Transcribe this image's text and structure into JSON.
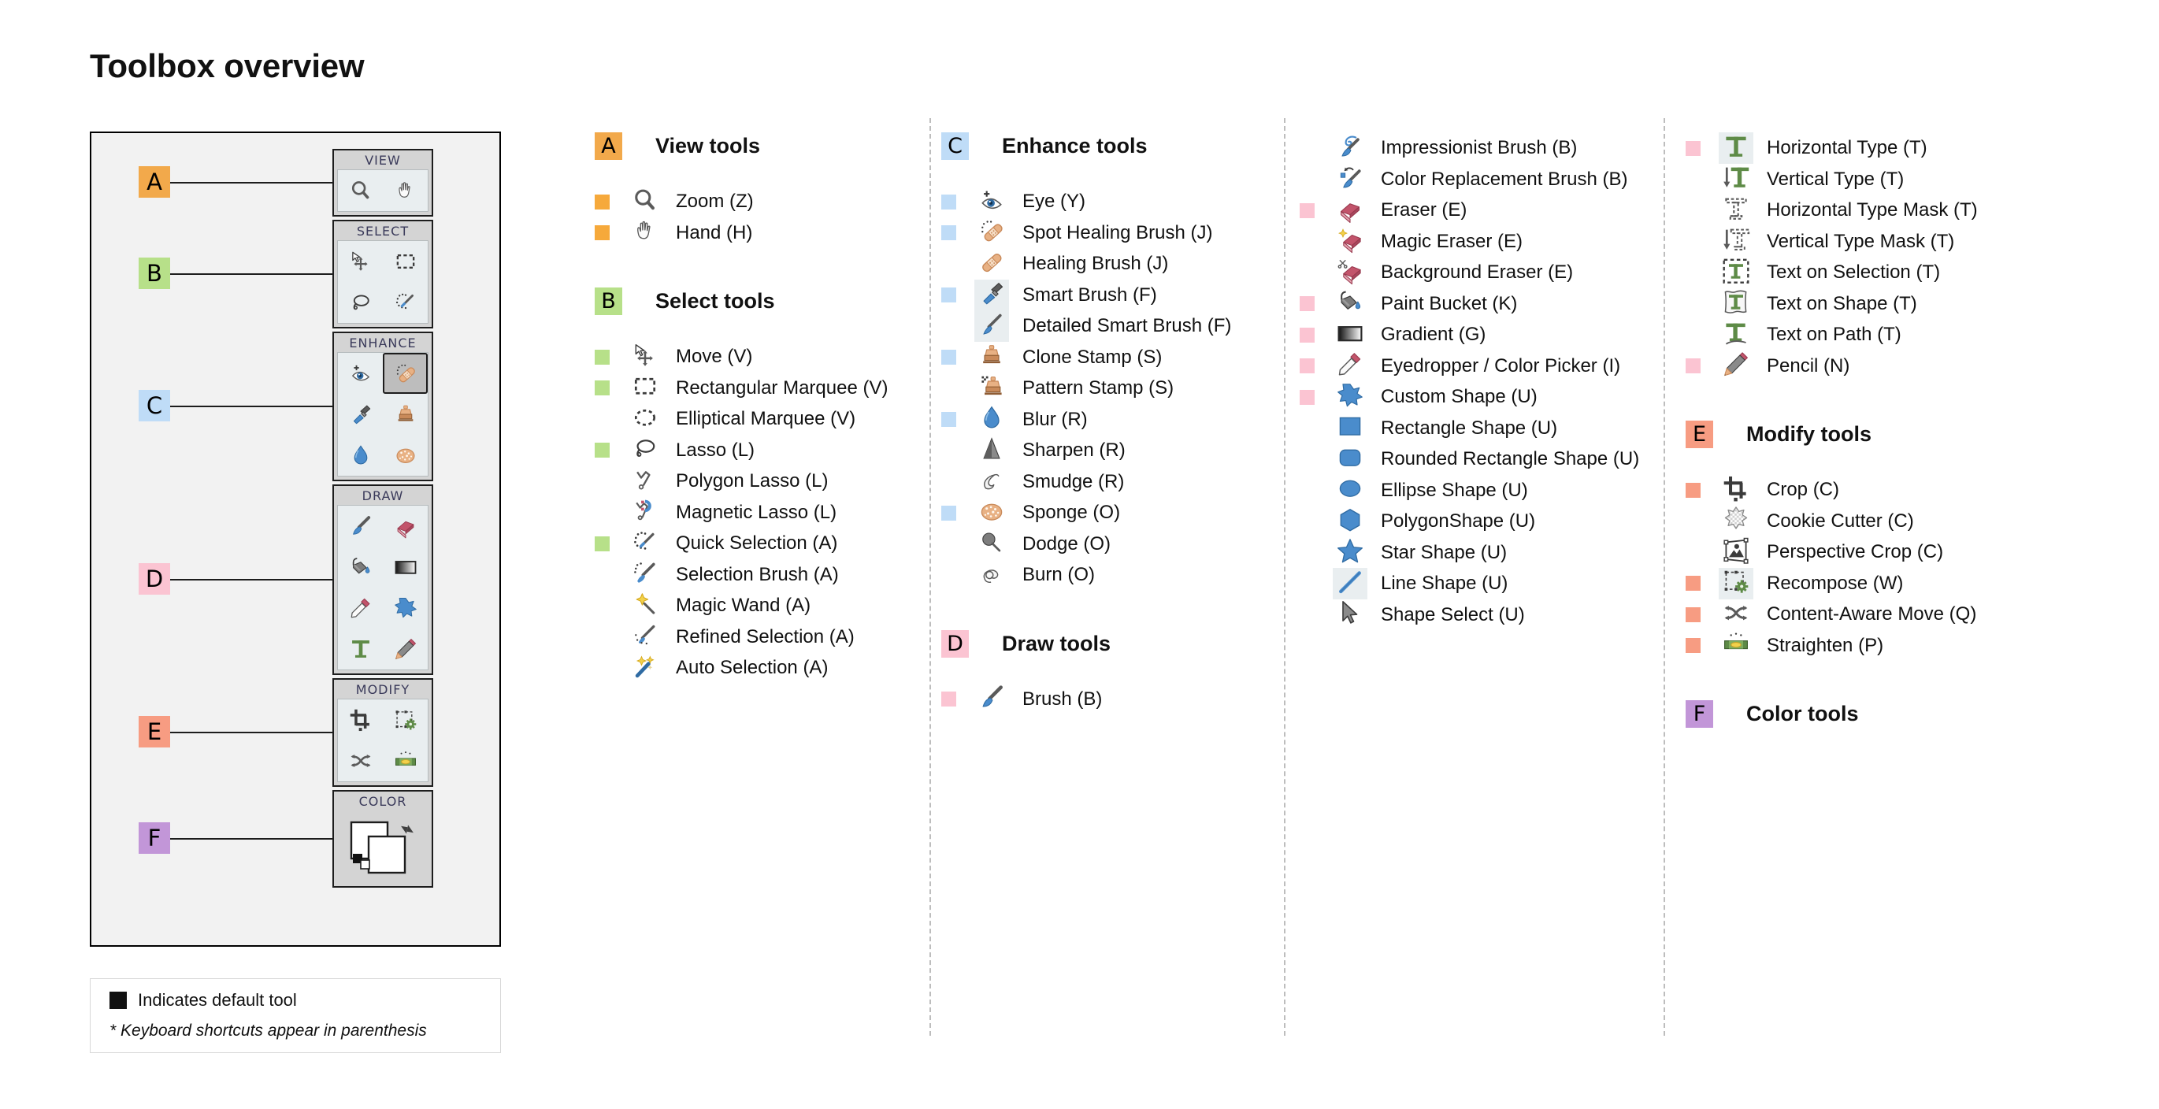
{
  "page_title": "Toolbox overview",
  "legend": {
    "default_tool_text": "Indicates default tool",
    "shortcut_note": "* Keyboard shortcuts appear in parenthesis",
    "swatch_color": "#111111"
  },
  "section_colors": {
    "A": "#f2a94b",
    "B": "#b7e089",
    "C": "#bfdcf7",
    "D": "#fbc4d2",
    "E": "#f79c82",
    "F": "#c296d8"
  },
  "dot_colors": {
    "A": "#f6a93b",
    "B": "#b7e089",
    "C": "#bfdcf7",
    "D": "#fbc4d2",
    "E": "#f79c82"
  },
  "toolbox": {
    "groups": [
      {
        "title": "VIEW",
        "callout": "A",
        "icons": [
          "zoom-icon",
          "hand-icon"
        ]
      },
      {
        "title": "SELECT",
        "callout": "B",
        "icons": [
          "move-icon",
          "rectangular-marquee-icon",
          "lasso-icon",
          "quick-selection-icon"
        ]
      },
      {
        "title": "ENHANCE",
        "callout": "C",
        "icons": [
          "eye-icon",
          "spot-healing-brush-icon",
          "smart-brush-icon",
          "clone-stamp-icon",
          "blur-icon",
          "sponge-icon"
        ],
        "selected_index": 1
      },
      {
        "title": "DRAW",
        "callout": "D",
        "icons": [
          "brush-icon",
          "eraser-icon",
          "paint-bucket-icon",
          "gradient-icon",
          "eyedropper-icon",
          "custom-shape-icon",
          "horizontal-type-icon",
          "pencil-icon"
        ]
      },
      {
        "title": "MODIFY",
        "callout": "E",
        "icons": [
          "crop-icon",
          "recompose-icon",
          "content-aware-move-icon",
          "straighten-icon"
        ]
      },
      {
        "title": "COLOR",
        "callout": "F",
        "icons": [
          "color-swatches-icon"
        ]
      }
    ]
  },
  "columns": [
    {
      "sections": [
        {
          "chip": "A",
          "label": "View tools",
          "tools": [
            {
              "name": "Zoom (Z)",
              "icon": "zoom-icon",
              "dot": "A"
            },
            {
              "name": "Hand (H)",
              "icon": "hand-icon",
              "dot": "A"
            }
          ]
        },
        {
          "chip": "B",
          "label": "Select tools",
          "tools": [
            {
              "name": "Move (V)",
              "icon": "move-icon",
              "dot": "B"
            },
            {
              "name": "Rectangular Marquee (V)",
              "icon": "rectangular-marquee-icon",
              "dot": "B"
            },
            {
              "name": "Elliptical Marquee (V)",
              "icon": "elliptical-marquee-icon",
              "dot": ""
            },
            {
              "name": "Lasso (L)",
              "icon": "lasso-icon",
              "dot": "B"
            },
            {
              "name": "Polygon Lasso (L)",
              "icon": "polygon-lasso-icon",
              "dot": ""
            },
            {
              "name": "Magnetic Lasso (L)",
              "icon": "magnetic-lasso-icon",
              "dot": ""
            },
            {
              "name": "Quick Selection  (A)",
              "icon": "quick-selection-icon",
              "dot": "B"
            },
            {
              "name": "Selection Brush (A)",
              "icon": "selection-brush-icon",
              "dot": ""
            },
            {
              "name": "Magic Wand (A)",
              "icon": "magic-wand-icon",
              "dot": ""
            },
            {
              "name": "Refined Selection (A)",
              "icon": "refined-selection-icon",
              "dot": ""
            },
            {
              "name": "Auto Selection (A)",
              "icon": "auto-selection-icon",
              "dot": ""
            }
          ]
        }
      ]
    },
    {
      "sections": [
        {
          "chip": "C",
          "label": "Enhance tools",
          "tools": [
            {
              "name": "Eye (Y)",
              "icon": "eye-icon",
              "dot": "C"
            },
            {
              "name": "Spot Healing Brush (J)",
              "icon": "spot-healing-brush-icon",
              "dot": "C"
            },
            {
              "name": "Healing Brush (J)",
              "icon": "healing-brush-icon",
              "dot": ""
            },
            {
              "name": "Smart Brush (F)",
              "icon": "smart-brush-icon",
              "dot": "C",
              "highlight": true
            },
            {
              "name": "Detailed Smart Brush (F)",
              "icon": "detailed-smart-brush-icon",
              "dot": "",
              "highlight": true
            },
            {
              "name": "Clone Stamp (S)",
              "icon": "clone-stamp-icon",
              "dot": "C"
            },
            {
              "name": "Pattern Stamp (S)",
              "icon": "pattern-stamp-icon",
              "dot": ""
            },
            {
              "name": "Blur (R)",
              "icon": "blur-icon",
              "dot": "C"
            },
            {
              "name": "Sharpen (R)",
              "icon": "sharpen-icon",
              "dot": ""
            },
            {
              "name": "Smudge (R)",
              "icon": "smudge-icon",
              "dot": ""
            },
            {
              "name": "Sponge (O)",
              "icon": "sponge-icon",
              "dot": "C"
            },
            {
              "name": "Dodge (O)",
              "icon": "dodge-icon",
              "dot": ""
            },
            {
              "name": "Burn (O)",
              "icon": "burn-icon",
              "dot": ""
            }
          ]
        },
        {
          "chip": "D",
          "label": "Draw tools",
          "tools": [
            {
              "name": "Brush (B)",
              "icon": "brush-icon",
              "dot": "D"
            }
          ]
        }
      ]
    },
    {
      "sections": [
        {
          "chip": "",
          "label": "",
          "tools": [
            {
              "name": "Impressionist Brush (B)",
              "icon": "impressionist-brush-icon",
              "dot": ""
            },
            {
              "name": "Color Replacement Brush (B)",
              "icon": "color-replacement-brush-icon",
              "dot": ""
            },
            {
              "name": "Eraser (E)",
              "icon": "eraser-icon",
              "dot": "D"
            },
            {
              "name": "Magic Eraser (E)",
              "icon": "magic-eraser-icon",
              "dot": ""
            },
            {
              "name": "Background Eraser (E)",
              "icon": "background-eraser-icon",
              "dot": ""
            },
            {
              "name": "Paint Bucket (K)",
              "icon": "paint-bucket-icon",
              "dot": "D"
            },
            {
              "name": "Gradient (G)",
              "icon": "gradient-icon",
              "dot": "D"
            },
            {
              "name": "Eyedropper / Color Picker (I)",
              "icon": "eyedropper-icon",
              "dot": "D"
            },
            {
              "name": "Custom Shape (U)",
              "icon": "custom-shape-icon",
              "dot": "D"
            },
            {
              "name": "Rectangle Shape (U)",
              "icon": "rectangle-shape-icon",
              "dot": ""
            },
            {
              "name": "Rounded Rectangle Shape (U)",
              "icon": "rounded-rectangle-shape-icon",
              "dot": ""
            },
            {
              "name": "Ellipse Shape (U)",
              "icon": "ellipse-shape-icon",
              "dot": ""
            },
            {
              "name": "PolygonShape (U)",
              "icon": "polygon-shape-icon",
              "dot": ""
            },
            {
              "name": "Star Shape (U)",
              "icon": "star-shape-icon",
              "dot": ""
            },
            {
              "name": "Line Shape (U)",
              "icon": "line-shape-icon",
              "dot": "",
              "highlight": true
            },
            {
              "name": "Shape Select (U)",
              "icon": "shape-select-icon",
              "dot": ""
            }
          ]
        }
      ]
    },
    {
      "sections": [
        {
          "chip": "",
          "label": "",
          "tools": [
            {
              "name": "Horizontal Type (T)",
              "icon": "horizontal-type-icon",
              "dot": "D",
              "highlight": true
            },
            {
              "name": "Vertical Type (T)",
              "icon": "vertical-type-icon",
              "dot": ""
            },
            {
              "name": "Horizontal Type Mask (T)",
              "icon": "horizontal-type-mask-icon",
              "dot": ""
            },
            {
              "name": "Vertical Type Mask (T)",
              "icon": "vertical-type-mask-icon",
              "dot": ""
            },
            {
              "name": "Text on Selection (T)",
              "icon": "text-on-selection-icon",
              "dot": ""
            },
            {
              "name": "Text on Shape (T)",
              "icon": "text-on-shape-icon",
              "dot": ""
            },
            {
              "name": "Text on Path (T)",
              "icon": "text-on-path-icon",
              "dot": ""
            },
            {
              "name": "Pencil (N)",
              "icon": "pencil-icon",
              "dot": "D"
            }
          ]
        },
        {
          "chip": "E",
          "label": "Modify tools",
          "tools": [
            {
              "name": "Crop (C)",
              "icon": "crop-icon",
              "dot": "E"
            },
            {
              "name": "Cookie Cutter (C)",
              "icon": "cookie-cutter-icon",
              "dot": ""
            },
            {
              "name": "Perspective Crop (C)",
              "icon": "perspective-crop-icon",
              "dot": ""
            },
            {
              "name": "Recompose (W)",
              "icon": "recompose-icon",
              "dot": "E",
              "highlight": true
            },
            {
              "name": "Content-Aware Move (Q)",
              "icon": "content-aware-move-icon",
              "dot": "E"
            },
            {
              "name": "Straighten (P)",
              "icon": "straighten-icon",
              "dot": "E"
            }
          ]
        },
        {
          "chip": "F",
          "label": "Color tools",
          "tools": []
        }
      ]
    }
  ]
}
